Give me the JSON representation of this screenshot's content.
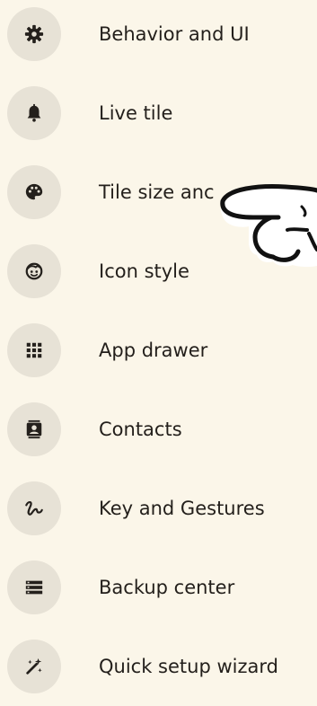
{
  "menu": {
    "items": [
      {
        "label": "Behavior and UI",
        "icon": "gear-icon"
      },
      {
        "label": "Live tile",
        "icon": "bell-icon"
      },
      {
        "label": "Tile size anc",
        "icon": "palette-icon"
      },
      {
        "label": "Icon style",
        "icon": "smiley-face-icon"
      },
      {
        "label": "App drawer",
        "icon": "grid-icon"
      },
      {
        "label": "Contacts",
        "icon": "contact-card-icon"
      },
      {
        "label": "Key and Gestures",
        "icon": "gesture-icon"
      },
      {
        "label": "Backup center",
        "icon": "stacked-bars-icon"
      },
      {
        "label": "Quick setup wizard",
        "icon": "magic-wand-icon"
      }
    ]
  },
  "overlay": {
    "icon": "pointing-hand-icon"
  },
  "colors": {
    "background": "#fbf6e9",
    "icon_circle": "#e7e2d6",
    "icon_glyph": "#24201c",
    "text": "#231f1b"
  }
}
